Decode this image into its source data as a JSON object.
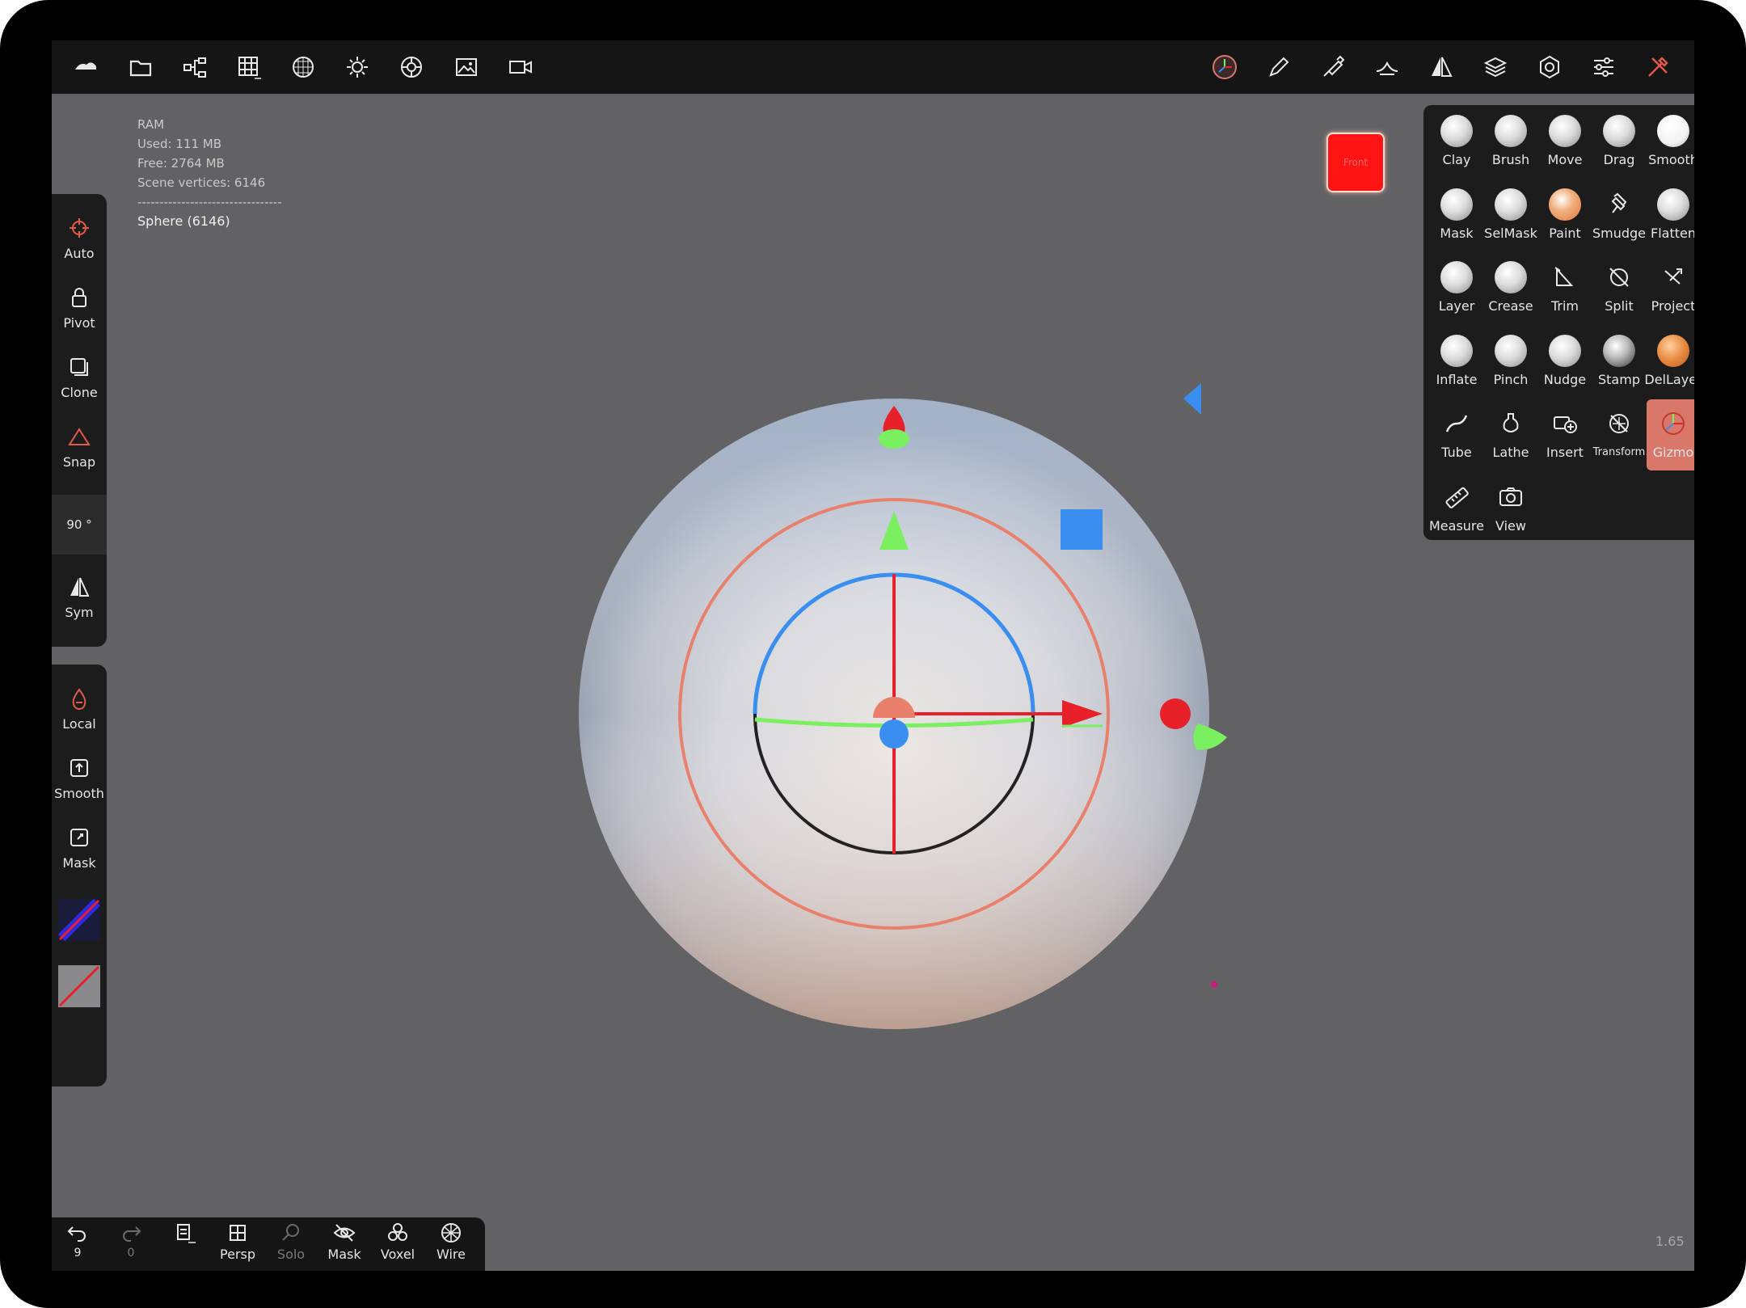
{
  "stats": {
    "ram_label": "RAM",
    "used": "Used: 111 MB",
    "free": "Free: 2764 MB",
    "vertices": "Scene vertices: 6146",
    "separator": "---------------------------------",
    "object": "Sphere (6146)"
  },
  "view_cube": {
    "label": "Front"
  },
  "top_toolbar": {
    "left_icons": [
      "nomad-logo-icon",
      "folder-icon",
      "scene-tree-icon",
      "grid-icon",
      "texture-sphere-icon",
      "light-sun-icon",
      "material-icon",
      "image-icon",
      "camera-icon"
    ],
    "right_icons": [
      "gizmo-orientation-icon",
      "pen-icon",
      "stroke-brush-icon",
      "falloff-icon",
      "symmetry-icon",
      "layers-icon",
      "settings-icon",
      "sliders-icon",
      "tools-icon"
    ]
  },
  "left_panel_top": [
    {
      "label": "Auto",
      "icon": "crosshair-icon"
    },
    {
      "label": "Pivot",
      "icon": "lock-icon"
    },
    {
      "label": "Clone",
      "icon": "clone-icon"
    },
    {
      "label": "Snap",
      "icon": "triangle-icon"
    },
    {
      "label": "90 °",
      "icon": ""
    },
    {
      "label": "Sym",
      "icon": "symmetry-icon"
    }
  ],
  "left_panel_bottom": [
    {
      "label": "Local",
      "icon": "drop-icon"
    },
    {
      "label": "Smooth",
      "icon": "smooth-box-icon"
    },
    {
      "label": "Mask",
      "icon": "mask-box-icon"
    }
  ],
  "brush_tools": [
    {
      "label": "Clay",
      "style": "ball"
    },
    {
      "label": "Brush",
      "style": "ball"
    },
    {
      "label": "Move",
      "style": "ball"
    },
    {
      "label": "Drag",
      "style": "ball"
    },
    {
      "label": "Smooth",
      "style": "ball"
    },
    {
      "label": "Mask",
      "style": "ball"
    },
    {
      "label": "SelMask",
      "style": "ball"
    },
    {
      "label": "Paint",
      "style": "ball"
    },
    {
      "label": "Smudge",
      "style": "icon"
    },
    {
      "label": "Flatten",
      "style": "ball"
    },
    {
      "label": "Layer",
      "style": "ball"
    },
    {
      "label": "Crease",
      "style": "ball"
    },
    {
      "label": "Trim",
      "style": "icon"
    },
    {
      "label": "Split",
      "style": "icon"
    },
    {
      "label": "Project",
      "style": "icon"
    },
    {
      "label": "Inflate",
      "style": "ball"
    },
    {
      "label": "Pinch",
      "style": "ball"
    },
    {
      "label": "Nudge",
      "style": "ball"
    },
    {
      "label": "Stamp",
      "style": "ball"
    },
    {
      "label": "DelLayer",
      "style": "ball"
    },
    {
      "label": "Tube",
      "style": "icon"
    },
    {
      "label": "Lathe",
      "style": "icon"
    },
    {
      "label": "Insert",
      "style": "icon"
    },
    {
      "label": "Transform",
      "style": "icon"
    },
    {
      "label": "Gizmo",
      "style": "icon",
      "active": true
    },
    {
      "label": "Measure",
      "style": "icon"
    },
    {
      "label": "View",
      "style": "icon"
    }
  ],
  "bottom_bar": {
    "undo_count": "9",
    "redo_count": "0",
    "persp": "Persp",
    "solo": "Solo",
    "mask": "Mask",
    "voxel": "Voxel",
    "wire": "Wire"
  },
  "version": "1.65",
  "colors": {
    "background": "#626264",
    "toolbar": "#151515",
    "panel": "#1c1c1c",
    "gizmo_active": "#d9786a",
    "axis_x": "#e8202a",
    "axis_y": "#7af060",
    "axis_z": "#3a8ef0"
  }
}
